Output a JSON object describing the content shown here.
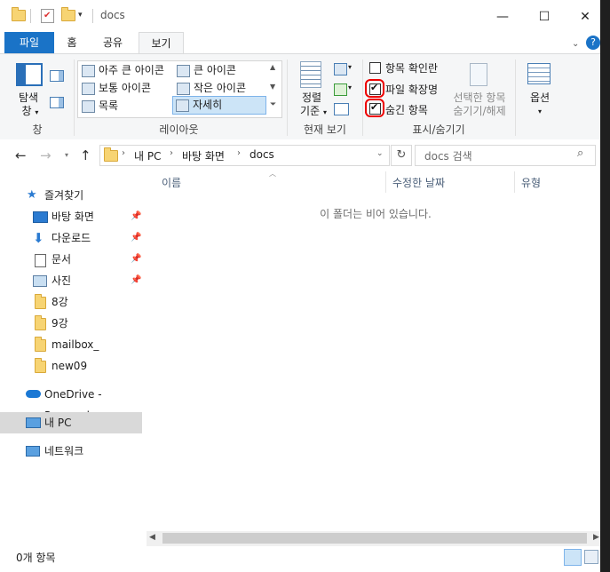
{
  "window": {
    "title": "docs",
    "minimize": "—",
    "maximize": "☐",
    "close": "✕"
  },
  "tabs": {
    "file": "파일",
    "home": "홈",
    "share": "공유",
    "view": "보기"
  },
  "ribbon": {
    "nav_pane": {
      "line1": "탐색",
      "line2": "창"
    },
    "pane_group": "창",
    "layout": {
      "items": [
        "아주 큰 아이콘",
        "큰 아이콘",
        "보통 아이콘",
        "작은 아이콘",
        "목록",
        "자세히"
      ],
      "selected": "자세히",
      "group": "레이아웃"
    },
    "sort": {
      "line1": "정렬",
      "line2": "기준"
    },
    "current_view_group": "현재 보기",
    "show_hide": {
      "item_checkboxes": "항목 확인란",
      "file_extensions": "파일 확장명",
      "hidden_items": "숨긴 항목",
      "item_checkboxes_checked": false,
      "file_extensions_checked": true,
      "hidden_items_checked": true,
      "hide_selected": {
        "line1": "선택한 항목",
        "line2": "숨기기/해제"
      },
      "group": "표시/숨기기"
    },
    "options": "옵션"
  },
  "address": {
    "crumbs": [
      "내 PC",
      "바탕 화면",
      "docs"
    ],
    "search_placeholder": "docs 검색"
  },
  "nav_pane": {
    "quick_access": "즐겨찾기",
    "items": [
      "바탕 화면",
      "다운로드",
      "문서",
      "사진",
      "8강",
      "9강",
      "mailbox_",
      "new09"
    ],
    "onedrive": "OneDrive - Personal",
    "this_pc": "내 PC",
    "network": "네트워크"
  },
  "columns": {
    "name": "이름",
    "modified": "수정한 날짜",
    "type": "유형"
  },
  "empty_message": "이 폴더는 비어 있습니다.",
  "status": {
    "count": "0개 항목"
  },
  "colors": {
    "accent": "#1a73c7",
    "selection": "#cce4f7",
    "annotation": "#e00000"
  }
}
